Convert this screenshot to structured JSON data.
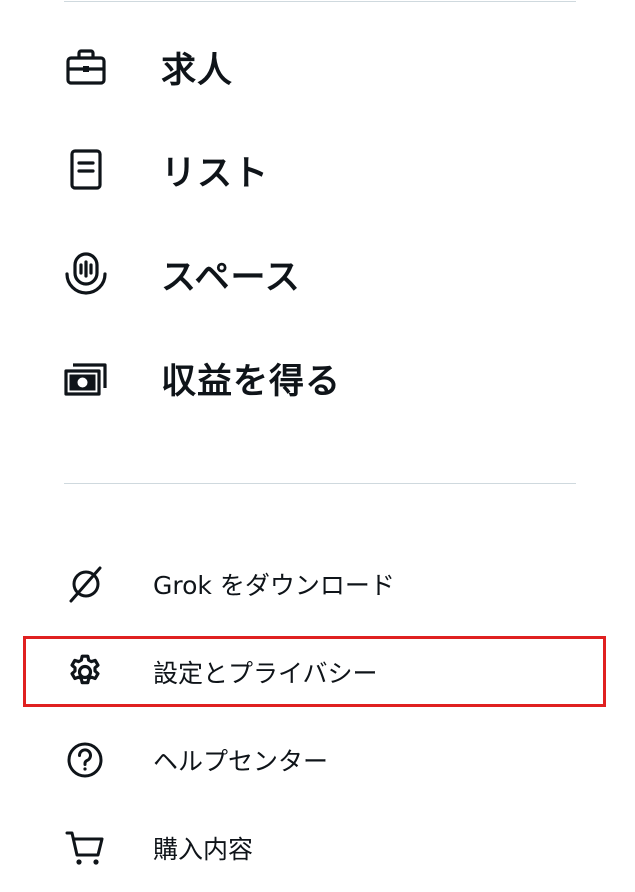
{
  "primary_menu": [
    {
      "label": "求人",
      "icon": "briefcase-icon"
    },
    {
      "label": "リスト",
      "icon": "list-icon"
    },
    {
      "label": "スペース",
      "icon": "spaces-icon"
    },
    {
      "label": "収益を得る",
      "icon": "money-icon"
    }
  ],
  "secondary_menu": [
    {
      "label": "Grok をダウンロード",
      "icon": "grok-icon"
    },
    {
      "label": "設定とプライバシー",
      "icon": "gear-icon"
    },
    {
      "label": "ヘルプセンター",
      "icon": "help-icon"
    },
    {
      "label": "購入内容",
      "icon": "cart-icon"
    }
  ],
  "highlight": {
    "target": "設定とプライバシー",
    "color": "#e02020"
  },
  "colors": {
    "text": "#0f1419",
    "divider": "#cfd9de"
  }
}
